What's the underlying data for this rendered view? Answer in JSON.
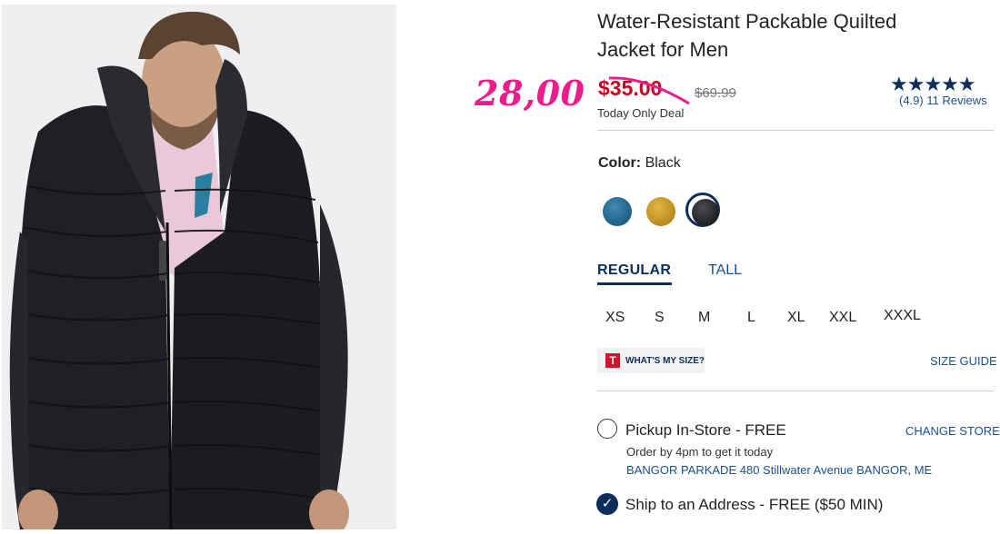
{
  "product": {
    "title_line1": "Water-Resistant Packable Quilted",
    "title_line2": "Jacket for Men"
  },
  "price": {
    "handwritten_sale": "28,00",
    "sale_price": "$35.00",
    "original_price": "$69.99",
    "deal_label": "Today Only Deal"
  },
  "rating": {
    "stars": "★★★★★",
    "value": 4.9,
    "value_text": "(4.9)",
    "reviews_text": "11 Reviews"
  },
  "color": {
    "label": "Color:",
    "selected": "Black",
    "swatches": [
      {
        "name": "teal",
        "color": "#2f759c"
      },
      {
        "name": "gold",
        "color": "#cf9f2f"
      },
      {
        "name": "black",
        "color": "#2c2d31",
        "selected": true
      }
    ]
  },
  "fit_tabs": [
    {
      "label": "REGULAR",
      "active": true
    },
    {
      "label": "TALL",
      "active": false
    }
  ],
  "sizes": [
    "XS",
    "S",
    "M",
    "L",
    "XL",
    "XXL",
    "XXXL"
  ],
  "size_tools": {
    "whats_my_size": "WHAT'S MY SIZE?",
    "t_logo": "T",
    "size_guide": "SIZE GUIDE"
  },
  "fulfillment": {
    "pickup_label": "Pickup In-Store - FREE",
    "change_store": "CHANGE STORE",
    "pickup_note": "Order by 4pm to get it today",
    "store_address": "BANGOR PARKADE 480 Stillwater Avenue  BANGOR, ME",
    "ship_label": "Ship to an Address - FREE ($50 MIN)",
    "ship_selected": true
  },
  "colors": {
    "brand_navy": "#0b2e5b",
    "link_blue": "#1a4f8f",
    "sale_red": "#c9001e",
    "overlay_pink": "#ee1c8a"
  }
}
